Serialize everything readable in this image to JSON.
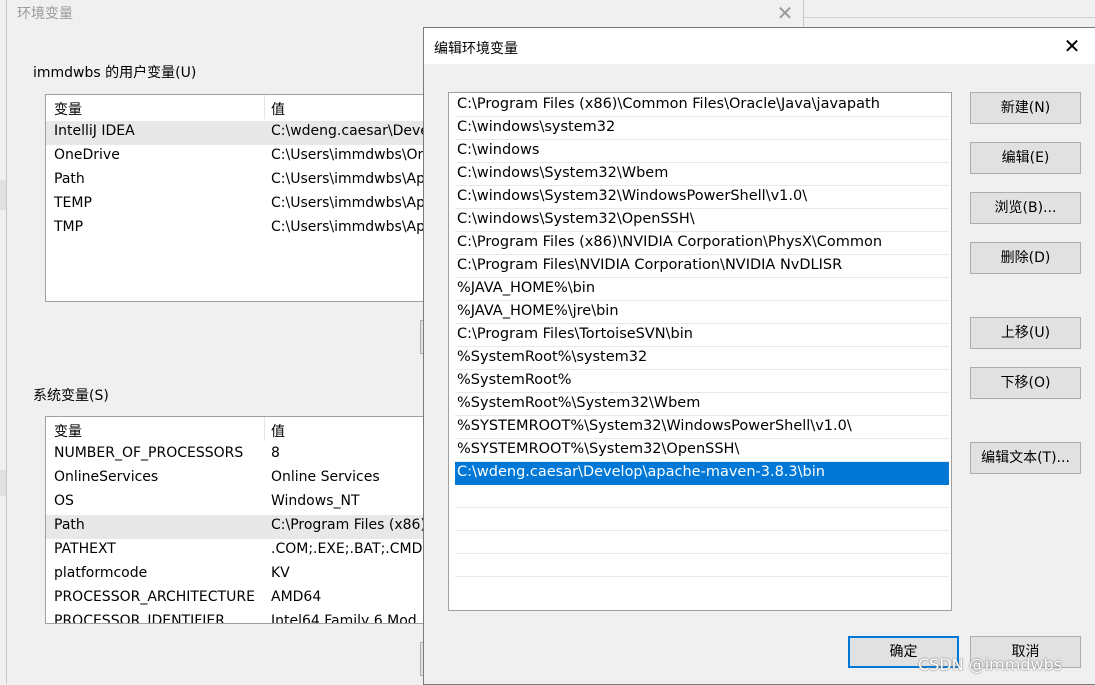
{
  "background_window": {
    "title": "环境变量",
    "close_glyph": "✕",
    "user_vars_label": "immdwbs 的用户变量(U)",
    "user_vars": {
      "headers": [
        "变量",
        "值"
      ],
      "rows": [
        {
          "name": "IntelliJ IDEA",
          "value": "C:\\wdeng.caesar\\Devel"
        },
        {
          "name": "OneDrive",
          "value": "C:\\Users\\immdwbs\\On"
        },
        {
          "name": "Path",
          "value": "C:\\Users\\immdwbs\\Ap"
        },
        {
          "name": "TEMP",
          "value": "C:\\Users\\immdwbs\\Ap"
        },
        {
          "name": "TMP",
          "value": "C:\\Users\\immdwbs\\Ap"
        }
      ]
    },
    "system_vars_label": "系统变量(S)",
    "system_vars": {
      "headers": [
        "变量",
        "值"
      ],
      "rows": [
        {
          "name": "NUMBER_OF_PROCESSORS",
          "value": "8"
        },
        {
          "name": "OnlineServices",
          "value": "Online Services"
        },
        {
          "name": "OS",
          "value": "Windows_NT"
        },
        {
          "name": "Path",
          "value": "C:\\Program Files (x86)"
        },
        {
          "name": "PATHEXT",
          "value": ".COM;.EXE;.BAT;.CMD;"
        },
        {
          "name": "platformcode",
          "value": "KV"
        },
        {
          "name": "PROCESSOR_ARCHITECTURE",
          "value": "AMD64"
        },
        {
          "name": "PROCESSOR_IDENTIFIER",
          "value": "Intel64 Family 6 Mod"
        }
      ]
    }
  },
  "dialog": {
    "title": "编辑环境变量",
    "close_glyph": "✕",
    "paths": [
      "C:\\Program Files (x86)\\Common Files\\Oracle\\Java\\javapath",
      "C:\\windows\\system32",
      "C:\\windows",
      "C:\\windows\\System32\\Wbem",
      "C:\\windows\\System32\\WindowsPowerShell\\v1.0\\",
      "C:\\windows\\System32\\OpenSSH\\",
      "C:\\Program Files (x86)\\NVIDIA Corporation\\PhysX\\Common",
      "C:\\Program Files\\NVIDIA Corporation\\NVIDIA NvDLISR",
      "%JAVA_HOME%\\bin",
      "%JAVA_HOME%\\jre\\bin",
      "C:\\Program Files\\TortoiseSVN\\bin",
      "%SystemRoot%\\system32",
      "%SystemRoot%",
      "%SystemRoot%\\System32\\Wbem",
      "%SYSTEMROOT%\\System32\\WindowsPowerShell\\v1.0\\",
      "%SYSTEMROOT%\\System32\\OpenSSH\\",
      "C:\\wdeng.caesar\\Develop\\apache-maven-3.8.3\\bin"
    ],
    "selected_index": 16,
    "buttons": {
      "new": "新建(N)",
      "edit": "编辑(E)",
      "browse": "浏览(B)...",
      "delete": "删除(D)",
      "move_up": "上移(U)",
      "move_down": "下移(O)",
      "edit_text": "编辑文本(T)...",
      "ok": "确定",
      "cancel": "取消"
    }
  },
  "watermark": "CSDN @immdwbs",
  "colors": {
    "selection": "#0078d7",
    "window_bg": "#f0f0f0"
  }
}
